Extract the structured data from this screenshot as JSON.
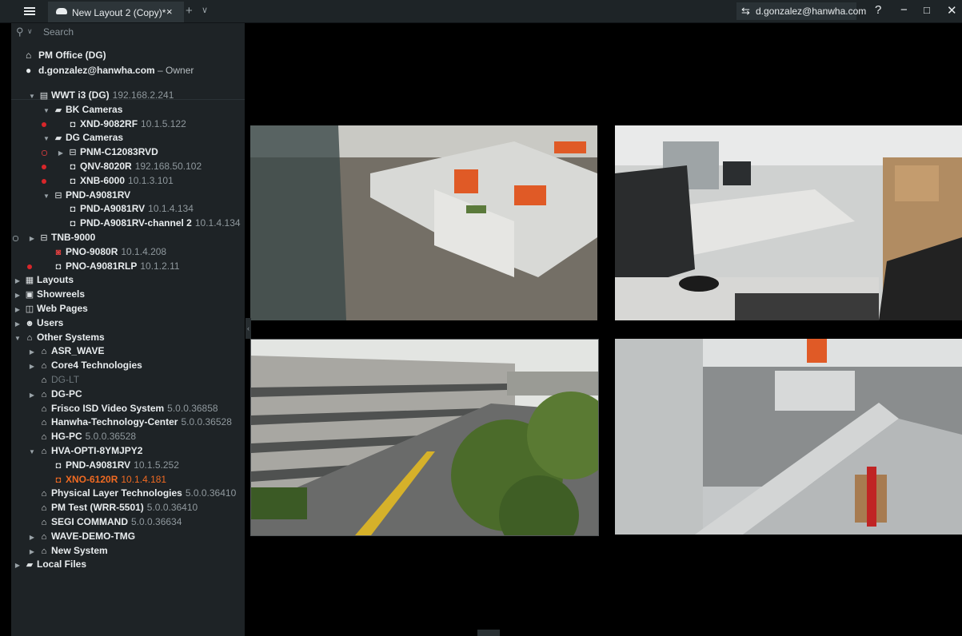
{
  "titlebar": {
    "tab_title": "New Layout 2 (Copy)*",
    "close_glyph": "×",
    "add_glyph": "+",
    "list_glyph": "∨",
    "user_email": "d.gonzalez@hanwha.com",
    "help": "?",
    "minimize": "−",
    "maximize": "□",
    "close": "✕"
  },
  "sidebar": {
    "search_placeholder": "Search",
    "site_name": "PM Office (DG)",
    "user": "d.gonzalez@hanwha.com",
    "role": " – Owner",
    "tree": [
      {
        "name": "WWT i3 (DG)",
        "ip": "192.168.2.241",
        "icon": "server-icon",
        "indent": 0,
        "arrow": "▼"
      },
      {
        "name": "BK Cameras",
        "ip": "",
        "icon": "folder-icon",
        "indent": 1,
        "arrow": "▼"
      },
      {
        "name": "XND-9082RF",
        "ip": "10.1.5.122",
        "icon": "camera-icon",
        "indent": 2,
        "arrow": "",
        "status": "red"
      },
      {
        "name": "DG Cameras",
        "ip": "",
        "icon": "folder-icon",
        "indent": 1,
        "arrow": "▼"
      },
      {
        "name": "PNM-C12083RVD",
        "ip": "",
        "icon": "multisensor-icon",
        "indent": 2,
        "arrow": "▶",
        "status": "ring"
      },
      {
        "name": "QNV-8020R",
        "ip": "192.168.50.102",
        "icon": "camera-icon",
        "indent": 2,
        "arrow": "",
        "status": "red"
      },
      {
        "name": "XNB-6000",
        "ip": "10.1.3.101",
        "icon": "camera-icon",
        "indent": 2,
        "arrow": "",
        "status": "red"
      },
      {
        "name": "PND-A9081RV",
        "ip": "",
        "icon": "multisensor-icon",
        "indent": 1,
        "arrow": "▼"
      },
      {
        "name": "PND-A9081RV",
        "ip": "10.1.4.134",
        "icon": "camera-icon",
        "indent": 2,
        "arrow": ""
      },
      {
        "name": "PND-A9081RV-channel 2",
        "ip": "10.1.4.134",
        "icon": "camera-icon",
        "indent": 2,
        "arrow": ""
      },
      {
        "name": "TNB-9000",
        "ip": "",
        "icon": "multisensor-icon",
        "indent": 0,
        "arrow": "▶",
        "status": "ringg"
      },
      {
        "name": "PNO-9080R",
        "ip": "10.1.4.208",
        "icon": "camera-offline-icon",
        "indent": 1,
        "arrow": ""
      },
      {
        "name": "PNO-A9081RLP",
        "ip": "10.1.2.11",
        "icon": "camera-icon",
        "indent": 0,
        "arrow": "",
        "status": "red",
        "extra": 1
      },
      {
        "name": "Layouts",
        "ip": "",
        "icon": "layouts-icon",
        "indent": -1,
        "arrow": "▶"
      },
      {
        "name": "Showreels",
        "ip": "",
        "icon": "showreels-icon",
        "indent": -1,
        "arrow": "▶"
      },
      {
        "name": "Web Pages",
        "ip": "",
        "icon": "webpage-icon",
        "indent": -1,
        "arrow": "▶"
      },
      {
        "name": "Users",
        "ip": "",
        "icon": "users-icon",
        "indent": -1,
        "arrow": "▶"
      },
      {
        "name": "Other Systems",
        "ip": "",
        "icon": "systems-icon",
        "indent": -1,
        "arrow": "▼"
      },
      {
        "name": "ASR_WAVE",
        "ip": "",
        "icon": "system-icon",
        "indent": 0,
        "arrow": "▶"
      },
      {
        "name": "Core4 Technologies",
        "ip": "",
        "icon": "system-icon",
        "indent": 0,
        "arrow": "▶"
      },
      {
        "name": "DG-LT",
        "ip": "",
        "icon": "system-offline-icon",
        "indent": 0,
        "arrow": "",
        "dim": true
      },
      {
        "name": "DG-PC",
        "ip": "",
        "icon": "system-icon",
        "indent": 0,
        "arrow": "▶"
      },
      {
        "name": "Frisco ISD Video System",
        "ip": "5.0.0.36858",
        "icon": "system-icon",
        "indent": 0,
        "arrow": ""
      },
      {
        "name": "Hanwha-Technology-Center",
        "ip": "5.0.0.36528",
        "icon": "system-icon",
        "indent": 0,
        "arrow": ""
      },
      {
        "name": "HG-PC",
        "ip": "5.0.0.36528",
        "icon": "system-icon",
        "indent": 0,
        "arrow": ""
      },
      {
        "name": "HVA-OPTI-8YMJPY2",
        "ip": "",
        "icon": "system-icon",
        "indent": 0,
        "arrow": "▼"
      },
      {
        "name": "PND-A9081RV",
        "ip": "10.1.5.252",
        "icon": "camera-icon",
        "indent": 1,
        "arrow": ""
      },
      {
        "name": "XNO-6120R",
        "ip": "10.1.4.181",
        "icon": "camera-icon",
        "indent": 1,
        "arrow": "",
        "selected": true
      },
      {
        "name": "Physical Layer Technologies",
        "ip": "5.0.0.36410",
        "icon": "system-icon",
        "indent": 0,
        "arrow": ""
      },
      {
        "name": "PM Test (WRR-5501)",
        "ip": "5.0.0.36410",
        "icon": "system-icon",
        "indent": 0,
        "arrow": ""
      },
      {
        "name": "SEGI COMMAND",
        "ip": "5.0.0.36634",
        "icon": "system-icon",
        "indent": 0,
        "arrow": ""
      },
      {
        "name": "WAVE-DEMO-TMG",
        "ip": "",
        "icon": "system-icon",
        "indent": 0,
        "arrow": "▶"
      },
      {
        "name": "New System",
        "ip": "",
        "icon": "system-icon",
        "indent": 0,
        "arrow": "▶"
      },
      {
        "name": "Local Files",
        "ip": "",
        "icon": "folder-icon",
        "indent": -1,
        "arrow": "▶"
      }
    ]
  },
  "colors": {
    "accent": "#f06a22",
    "offline": "#d8262a",
    "bg": "#1e2326"
  }
}
